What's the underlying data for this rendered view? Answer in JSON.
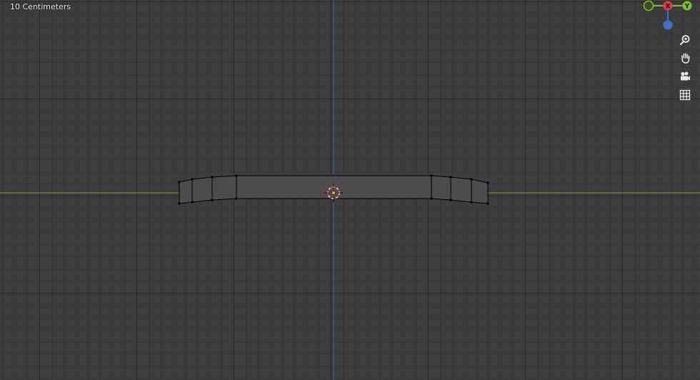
{
  "viewport": {
    "grid_scale_label": "10 Centimeters"
  },
  "gizmo": {
    "x_label": "X",
    "y_label": "Y",
    "x_color": "#e8334a",
    "y_color": "#7fbf2e",
    "z_color": "#3a72c4"
  },
  "axes": {
    "x_axis_color": "#7e9a2f",
    "z_axis_color": "#3a62a8"
  },
  "navigation": {
    "tools": [
      "zoom-icon",
      "hand-pan-icon",
      "camera-icon",
      "grid-ortho-icon"
    ]
  },
  "mesh": {
    "fill_color": "#4d4d4d",
    "edge_color": "#000000",
    "vertex_color": "#000000"
  }
}
